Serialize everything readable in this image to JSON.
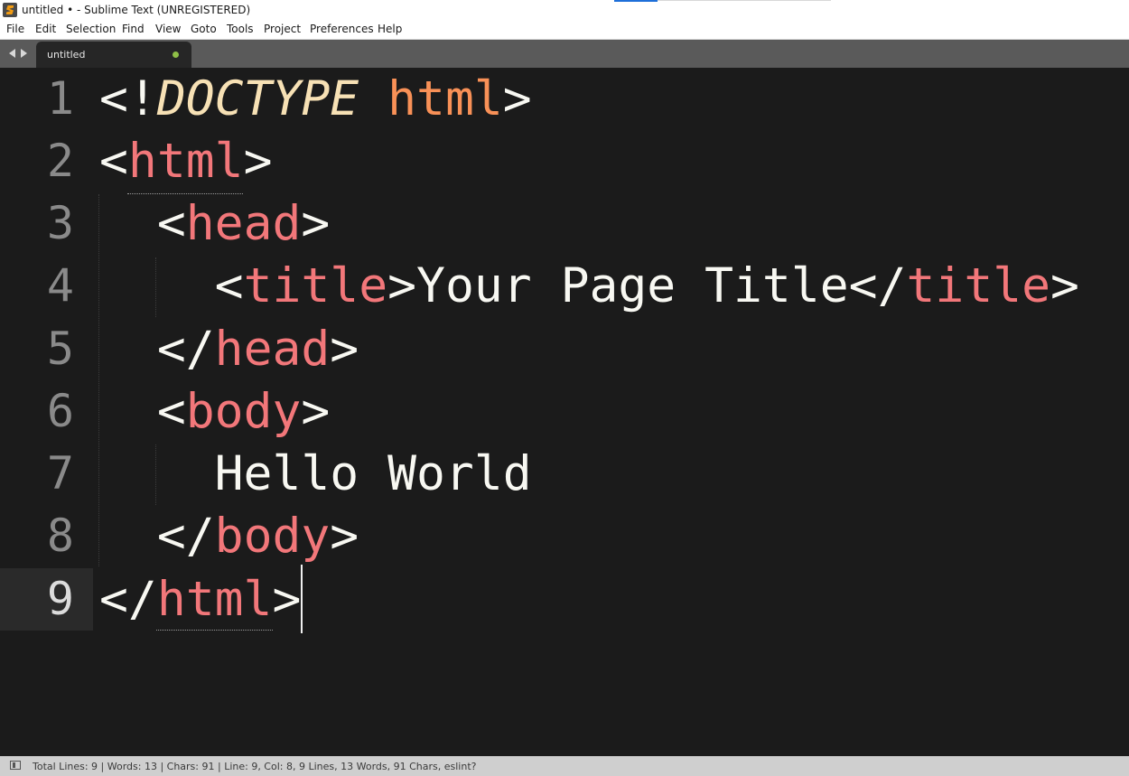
{
  "window": {
    "title": "untitled • - Sublime Text (UNREGISTERED)",
    "app_icon": "sublime-text-logo"
  },
  "menu": [
    "File",
    "Edit",
    "Selection",
    "Find",
    "View",
    "Goto",
    "Tools",
    "Project",
    "Preferences",
    "Help"
  ],
  "tabs": [
    {
      "label": "untitled",
      "dirty": true
    }
  ],
  "editor": {
    "current_line": 9,
    "line_numbers": [
      "1",
      "2",
      "3",
      "4",
      "5",
      "6",
      "7",
      "8",
      "9"
    ],
    "lines": [
      {
        "indent": "",
        "tokens": [
          {
            "t": "<!",
            "c": "punc"
          },
          {
            "t": "DOCTYPE",
            "c": "doctype"
          },
          {
            "t": " ",
            "c": "text"
          },
          {
            "t": "html",
            "c": "kw"
          },
          {
            "t": ">",
            "c": "punc"
          }
        ]
      },
      {
        "indent": "",
        "tokens": [
          {
            "t": "<",
            "c": "punc"
          },
          {
            "t": "html",
            "c": "tag"
          },
          {
            "t": ">",
            "c": "punc"
          }
        ]
      },
      {
        "indent": "  ",
        "tokens": [
          {
            "t": "<",
            "c": "punc"
          },
          {
            "t": "head",
            "c": "tag"
          },
          {
            "t": ">",
            "c": "punc"
          }
        ]
      },
      {
        "indent": "    ",
        "tokens": [
          {
            "t": "<",
            "c": "punc"
          },
          {
            "t": "title",
            "c": "tag"
          },
          {
            "t": ">",
            "c": "punc"
          },
          {
            "t": "Your Page Title",
            "c": "text"
          },
          {
            "t": "</",
            "c": "punc"
          },
          {
            "t": "title",
            "c": "tag"
          },
          {
            "t": ">",
            "c": "punc"
          }
        ]
      },
      {
        "indent": "  ",
        "tokens": [
          {
            "t": "</",
            "c": "punc"
          },
          {
            "t": "head",
            "c": "tag"
          },
          {
            "t": ">",
            "c": "punc"
          }
        ]
      },
      {
        "indent": "  ",
        "tokens": [
          {
            "t": "<",
            "c": "punc"
          },
          {
            "t": "body",
            "c": "tag"
          },
          {
            "t": ">",
            "c": "punc"
          }
        ]
      },
      {
        "indent": "    ",
        "tokens": [
          {
            "t": "Hello World",
            "c": "text"
          }
        ]
      },
      {
        "indent": "  ",
        "tokens": [
          {
            "t": "</",
            "c": "punc"
          },
          {
            "t": "body",
            "c": "tag"
          },
          {
            "t": ">",
            "c": "punc"
          }
        ]
      },
      {
        "indent": "",
        "tokens": [
          {
            "t": "</",
            "c": "punc"
          },
          {
            "t": "html",
            "c": "tag"
          },
          {
            "t": ">",
            "c": "punc"
          }
        ]
      }
    ]
  },
  "colors": {
    "editor_bg": "#1b1b1b",
    "tag": "#f2777a",
    "doctype": "#f7e1b5",
    "keyword": "#f99157",
    "text": "#f8f8f2",
    "gutter": "#8a8a8a"
  },
  "status": {
    "text": "Total Lines: 9 | Words: 13 | Chars: 91 | Line: 9, Col: 8, 9 Lines, 13 Words, 91 Chars, eslint?",
    "panel_icon": "panel-toggle-icon"
  }
}
